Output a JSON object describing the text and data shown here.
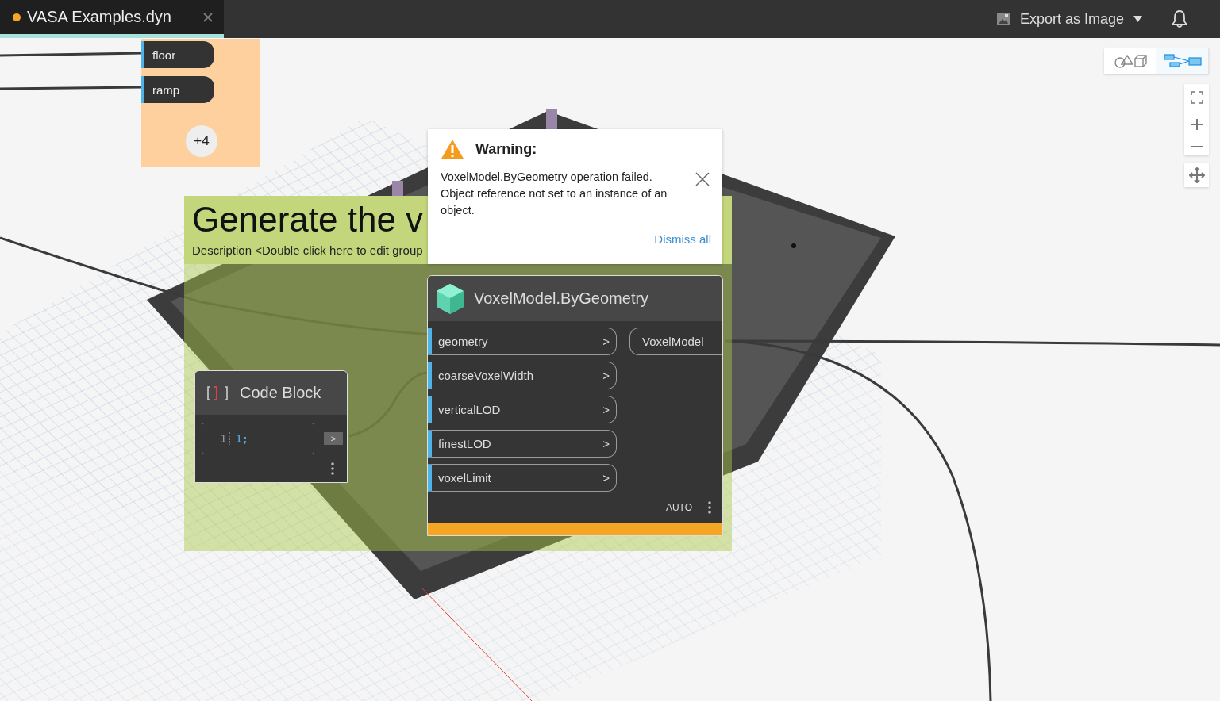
{
  "tab": {
    "title": "VASA Examples.dyn",
    "unsaved": true
  },
  "toolbar": {
    "export_label": "Export as Image"
  },
  "view_toggle": [
    {
      "kind": "geometry",
      "selected": false
    },
    {
      "kind": "graph",
      "selected": true
    }
  ],
  "watch_node": {
    "ports": [
      "floor",
      "ramp"
    ],
    "more": "+4"
  },
  "group": {
    "title": "Generate the v",
    "description": "Description <Double click here to edit group"
  },
  "warning": {
    "heading": "Warning:",
    "message": "VoxelModel.ByGeometry operation failed. Object reference not set to an instance of an object.",
    "dismiss": "Dismiss all"
  },
  "code_block": {
    "title": "Code Block",
    "line_number": "1",
    "code": "1;",
    "output_arrow": ">"
  },
  "node": {
    "title": "VoxelModel.ByGeometry",
    "warning": true,
    "run_mode": "AUTO",
    "output": "VoxelModel",
    "inputs": [
      {
        "name": "geometry",
        "arrow": ">"
      },
      {
        "name": "coarseVoxelWidth",
        "arrow": ">"
      },
      {
        "name": "verticalLOD",
        "arrow": ">"
      },
      {
        "name": "finestLOD",
        "arrow": ">"
      },
      {
        "name": "voxelLimit",
        "arrow": ">"
      }
    ]
  }
}
